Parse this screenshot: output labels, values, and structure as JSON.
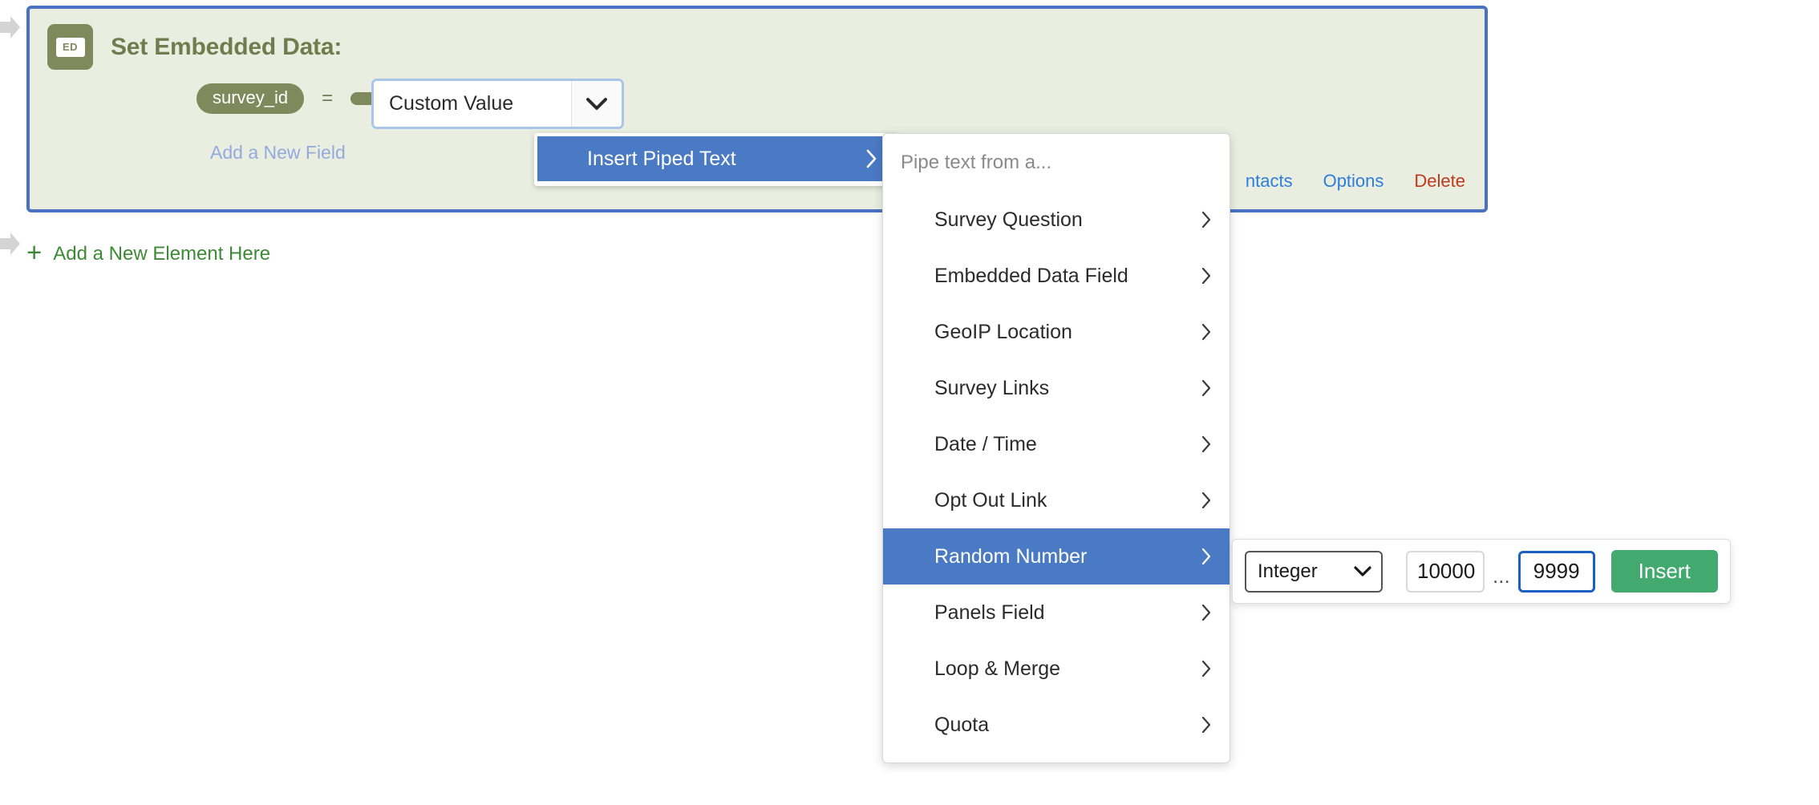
{
  "panel": {
    "title": "Set Embedded Data:",
    "badge_label": "ED",
    "field_name": "survey_id",
    "equals": "=",
    "hidden_pill": "",
    "value_select": "Custom Value",
    "caret_icon": "chevron-down-icon",
    "add_field_label": "Add a New Field",
    "actions": [
      {
        "label": "ntacts",
        "kind": "blue"
      },
      {
        "label": "Options",
        "kind": "blue"
      },
      {
        "label": "Delete",
        "kind": "red"
      }
    ]
  },
  "add_element": {
    "plus": "+",
    "label": "Add a New Element Here"
  },
  "insert_piped_text": {
    "label": "Insert Piped Text",
    "chevron": "chevron-right-icon"
  },
  "piped_text_menu": {
    "header": "Pipe text from a...",
    "items": [
      {
        "label": "Survey Question",
        "active": false
      },
      {
        "label": "Embedded Data Field",
        "active": false
      },
      {
        "label": "GeoIP Location",
        "active": false
      },
      {
        "label": "Survey Links",
        "active": false
      },
      {
        "label": "Date / Time",
        "active": false
      },
      {
        "label": "Opt Out Link",
        "active": false
      },
      {
        "label": "Random Number",
        "active": true
      },
      {
        "label": "Panels Field",
        "active": false
      },
      {
        "label": "Loop & Merge",
        "active": false
      },
      {
        "label": "Quota",
        "active": false
      }
    ]
  },
  "random_number": {
    "type_select": "Integer",
    "type_caret": "chevron-down-icon",
    "min_value": "10000",
    "range_separator": "...",
    "max_value": "9999",
    "insert_label": "Insert"
  },
  "colors": {
    "panel_bg": "#eaeee0",
    "panel_border": "#4a72c4",
    "olive": "#7e8a5c",
    "accent_blue": "#4a7ac4",
    "green": "#42a96f",
    "link_blue": "#2d7ddc",
    "link_red": "#c0391b",
    "add_green": "#3c8a35"
  }
}
